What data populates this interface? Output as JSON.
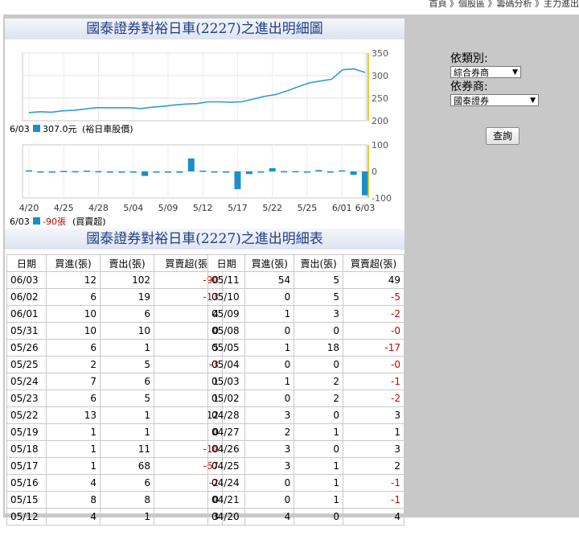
{
  "breadcrumb": "首頁 》個股區 》籌碼分析 》主力進出",
  "chart_data": {
    "title": "國泰證券對裕日車(2227)之進出明細圖",
    "type": "line+bar",
    "x_dates": [
      "4/20",
      "4/21",
      "4/24",
      "4/25",
      "4/26",
      "4/27",
      "4/28",
      "5/02",
      "5/03",
      "5/04",
      "5/05",
      "5/08",
      "5/09",
      "5/10",
      "5/11",
      "5/12",
      "5/15",
      "5/16",
      "5/17",
      "5/18",
      "5/19",
      "5/22",
      "5/23",
      "5/24",
      "5/25",
      "5/26",
      "5/31",
      "6/01",
      "6/02",
      "6/03"
    ],
    "x_tick_labels": [
      "4/20",
      "4/25",
      "4/28",
      "5/04",
      "5/09",
      "5/12",
      "5/17",
      "5/22",
      "5/25",
      "6/01",
      "6/03"
    ],
    "price": {
      "name": "裕日車股價",
      "last_label": "6/03",
      "last_value": "307.0元",
      "ylim": [
        200,
        350
      ],
      "yticks": [
        "350",
        "300",
        "250",
        "200"
      ],
      "values": [
        218,
        220,
        219,
        222,
        223,
        226,
        229,
        229,
        229,
        229,
        227,
        230,
        232,
        235,
        237,
        238,
        242,
        242,
        241,
        242,
        248,
        254,
        258,
        266,
        275,
        284,
        288,
        292,
        313,
        315,
        307
      ]
    },
    "net": {
      "name": "買賣超",
      "last_label": "6/03",
      "last_value": "-90張",
      "ylim": [
        -100,
        100
      ],
      "yticks": [
        "100",
        "0",
        "-100"
      ],
      "values": [
        4,
        -1,
        -1,
        2,
        1,
        3,
        1,
        -2,
        -1,
        0,
        -17,
        0,
        -2,
        -5,
        49,
        3,
        -1,
        -2,
        -67,
        -10,
        0,
        12,
        1,
        1,
        -3,
        5,
        0,
        4,
        -13,
        -90
      ]
    },
    "colors": {
      "price": "#2a9fd6",
      "bar": "#1a8fc9",
      "cursor": "#e6b800"
    }
  },
  "controls": {
    "category_label": "依類別:",
    "category_value": "綜合券商",
    "broker_label": "依券商:",
    "broker_value": "國泰證券",
    "query_label": "查詢"
  },
  "table": {
    "title": "國泰證券對裕日車(2227)之進出明細表",
    "headers": [
      "日期",
      "買進(張)",
      "賣出(張)",
      "買賣超(張)"
    ],
    "left": [
      [
        "06/03",
        "12",
        "102",
        "-90"
      ],
      [
        "06/02",
        "6",
        "19",
        "-13"
      ],
      [
        "06/01",
        "10",
        "6",
        "4"
      ],
      [
        "05/31",
        "10",
        "10",
        "0"
      ],
      [
        "05/26",
        "6",
        "1",
        "5"
      ],
      [
        "05/25",
        "2",
        "5",
        "-3"
      ],
      [
        "05/24",
        "7",
        "6",
        "1"
      ],
      [
        "05/23",
        "6",
        "5",
        "1"
      ],
      [
        "05/22",
        "13",
        "1",
        "12"
      ],
      [
        "05/19",
        "1",
        "1",
        "0"
      ],
      [
        "05/18",
        "1",
        "11",
        "-10"
      ],
      [
        "05/17",
        "1",
        "68",
        "-67"
      ],
      [
        "05/16",
        "4",
        "6",
        "-2"
      ],
      [
        "05/15",
        "8",
        "8",
        "0"
      ],
      [
        "05/12",
        "4",
        "1",
        "3"
      ]
    ],
    "right": [
      [
        "05/11",
        "54",
        "5",
        "49"
      ],
      [
        "05/10",
        "0",
        "5",
        "-5"
      ],
      [
        "05/09",
        "1",
        "3",
        "-2"
      ],
      [
        "05/08",
        "0",
        "0",
        "-0"
      ],
      [
        "05/05",
        "1",
        "18",
        "-17"
      ],
      [
        "05/04",
        "0",
        "0",
        "-0"
      ],
      [
        "05/03",
        "1",
        "2",
        "-1"
      ],
      [
        "05/02",
        "0",
        "2",
        "-2"
      ],
      [
        "04/28",
        "3",
        "0",
        "3"
      ],
      [
        "04/27",
        "2",
        "1",
        "1"
      ],
      [
        "04/26",
        "3",
        "0",
        "3"
      ],
      [
        "04/25",
        "3",
        "1",
        "2"
      ],
      [
        "04/24",
        "0",
        "1",
        "-1"
      ],
      [
        "04/21",
        "0",
        "1",
        "-1"
      ],
      [
        "04/20",
        "4",
        "0",
        "4"
      ]
    ]
  }
}
